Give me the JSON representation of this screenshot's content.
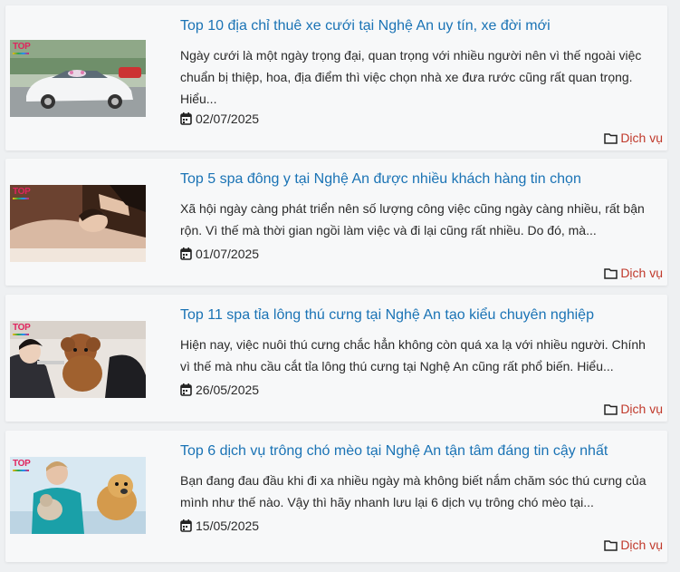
{
  "posts": [
    {
      "title": "Top 10 địa chỉ thuê xe cưới tại Nghệ An uy tín, xe đời mới",
      "excerpt": "Ngày cưới là một ngày trọng đại, quan trọng với nhiều người nên vì thế ngoài việc chuẩn bị thiệp, hoa, địa điểm thì việc chọn nhà xe đưa rước cũng rất quan trọng. Hiểu...",
      "date": "02/07/2025",
      "category": "Dịch vụ",
      "thumb_badge": "TOP"
    },
    {
      "title": "Top 5 spa đông y tại Nghệ An được nhiều khách hàng tin chọn",
      "excerpt": "Xã hội ngày càng phát triển nên số lượng công việc cũng ngày càng nhiều, rất bận rộn. Vì thế mà thời gian ngồi làm việc và đi lại cũng rất nhiều. Do đó, mà...",
      "date": "01/07/2025",
      "category": "Dịch vụ",
      "thumb_badge": "TOP"
    },
    {
      "title": "Top 11 spa tỉa lông thú cưng tại Nghệ An tạo kiểu chuyên nghiệp",
      "excerpt": "Hiện nay, việc nuôi thú cưng chắc hẳn không còn quá xa lạ với nhiều người. Chính vì thế mà nhu cầu cắt tỉa lông thú cưng tại Nghệ An cũng rất phổ biến. Hiểu...",
      "date": "26/05/2025",
      "category": "Dịch vụ",
      "thumb_badge": "TOP"
    },
    {
      "title": "Top 6 dịch vụ trông chó mèo tại Nghệ An tận tâm đáng tin cậy nhất",
      "excerpt": "Bạn đang đau đầu khi đi xa nhiều ngày mà không biết nắm chăm sóc thú cưng của mình như thế nào. Vậy thì hãy nhanh lưu lại 6 dịch vụ trông chó mèo tại...",
      "date": "15/05/2025",
      "category": "Dịch vụ",
      "thumb_badge": "TOP"
    }
  ],
  "icons": {
    "date": "calendar-icon",
    "category": "folder-icon"
  },
  "colors": {
    "title": "#1a73b5",
    "category": "#c0392b",
    "card_bg": "#f7f8f9"
  }
}
